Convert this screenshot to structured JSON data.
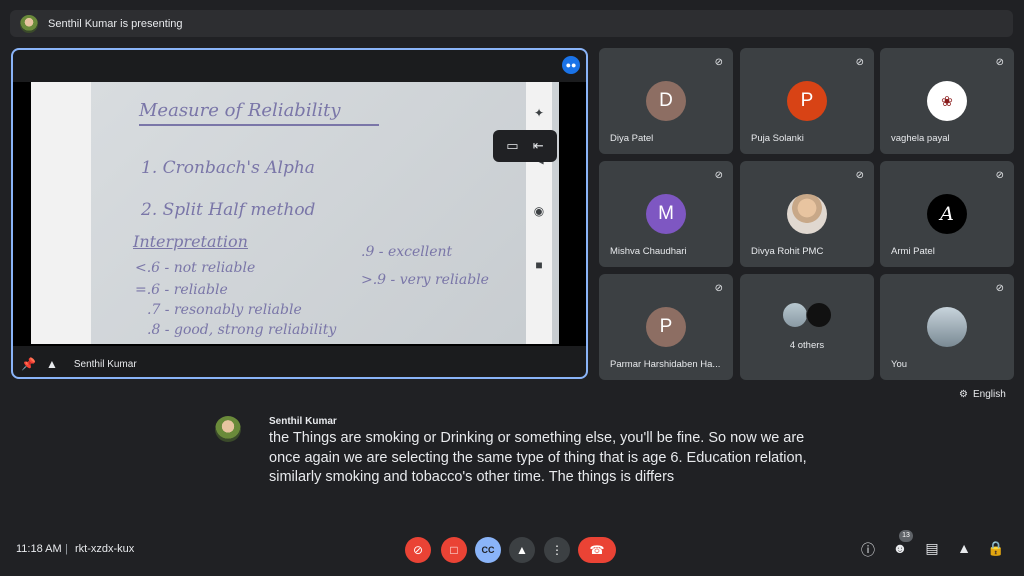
{
  "topbar": {
    "presenting_text": "Senthil Kumar is presenting"
  },
  "stage": {
    "presenter_name": "Senthil Kumar",
    "handwriting": {
      "title": "Measure of Reliability",
      "line1": "1. Cronbach's Alpha",
      "line2": "2. Split Half method",
      "interpretation": "Interpretation",
      "l_a": "<.6 - not reliable",
      "l_b": "=.6 - reliable",
      "l_c": ".7 - resonably reliable",
      "l_d": ".8 - good, strong reliability",
      "r_a": ".9 - excellent",
      "r_b": ">.9 - very reliable"
    }
  },
  "participants": [
    {
      "initial": "D",
      "name": "Diya Patel",
      "color": "#8d6e63"
    },
    {
      "initial": "P",
      "name": "Puja Solanki",
      "color": "#d84315"
    },
    {
      "initial": "",
      "name": "vaghela payal",
      "color": "#ffffff"
    },
    {
      "initial": "M",
      "name": "Mishva Chaudhari",
      "color": "#7e57c2"
    },
    {
      "initial": "",
      "name": "Divya Rohit PMC",
      "color": "#e0d8d0"
    },
    {
      "initial": "A",
      "name": "Armi Patel",
      "color": "#000000"
    },
    {
      "initial": "P",
      "name": "Parmar Harshidaben Ha...",
      "color": "#8d6e63"
    },
    {
      "initial": "",
      "name": "4 others",
      "color": "#5f6368"
    },
    {
      "initial": "",
      "name": "You",
      "color": "#9fb0bc"
    }
  ],
  "caption_language": "English",
  "caption": {
    "speaker": "Senthil Kumar",
    "text": "the Things are smoking or Drinking or something else, you'll be fine. So now we are once again we are selecting the same type of thing that is age 6. Education relation, similarly smoking and tobacco's other time. The things is differs"
  },
  "bottombar": {
    "time": "11:18 AM",
    "separator": "|",
    "meeting_code": "rkt-xzdx-kux",
    "people_count": "13"
  },
  "colors": {
    "accent": "#8ab4f8",
    "danger": "#ea4335",
    "cc_active": "#8ab4f8"
  }
}
